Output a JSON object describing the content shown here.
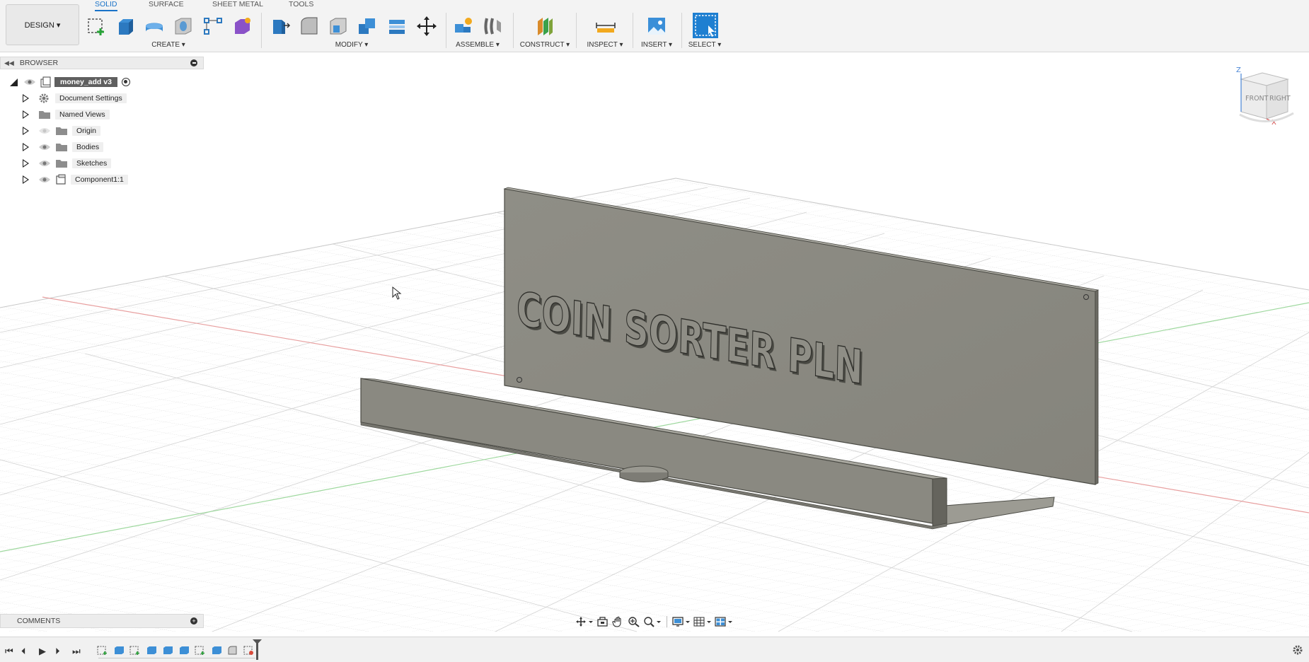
{
  "workspace": {
    "label": "DESIGN ▾"
  },
  "tabs": [
    "SOLID",
    "SURFACE",
    "SHEET METAL",
    "TOOLS"
  ],
  "groups": {
    "create": "CREATE ▾",
    "modify": "MODIFY ▾",
    "assemble": "ASSEMBLE ▾",
    "construct": "CONSTRUCT ▾",
    "inspect": "INSPECT ▾",
    "insert": "INSERT ▾",
    "select": "SELECT ▾"
  },
  "browser": {
    "title": "BROWSER",
    "root": "money_add v3",
    "items": [
      {
        "label": "Document Settings",
        "icon": "gear-icon"
      },
      {
        "label": "Named Views",
        "icon": "folder-icon"
      },
      {
        "label": "Origin",
        "icon": "folder-icon"
      },
      {
        "label": "Bodies",
        "icon": "folder-icon"
      },
      {
        "label": "Sketches",
        "icon": "folder-icon"
      },
      {
        "label": "Component1:1",
        "icon": "component-icon"
      }
    ]
  },
  "comments": {
    "title": "COMMENTS"
  },
  "model": {
    "embossed_text": "COIN SORTER PLN"
  },
  "viewcube": {
    "front": "FRONT",
    "right": "RIGHT",
    "z_axis": "Z",
    "x_axis": "X"
  },
  "colors": {
    "accent": "#1a73c8",
    "body": "#8e8d84",
    "background": "#ffffff"
  }
}
